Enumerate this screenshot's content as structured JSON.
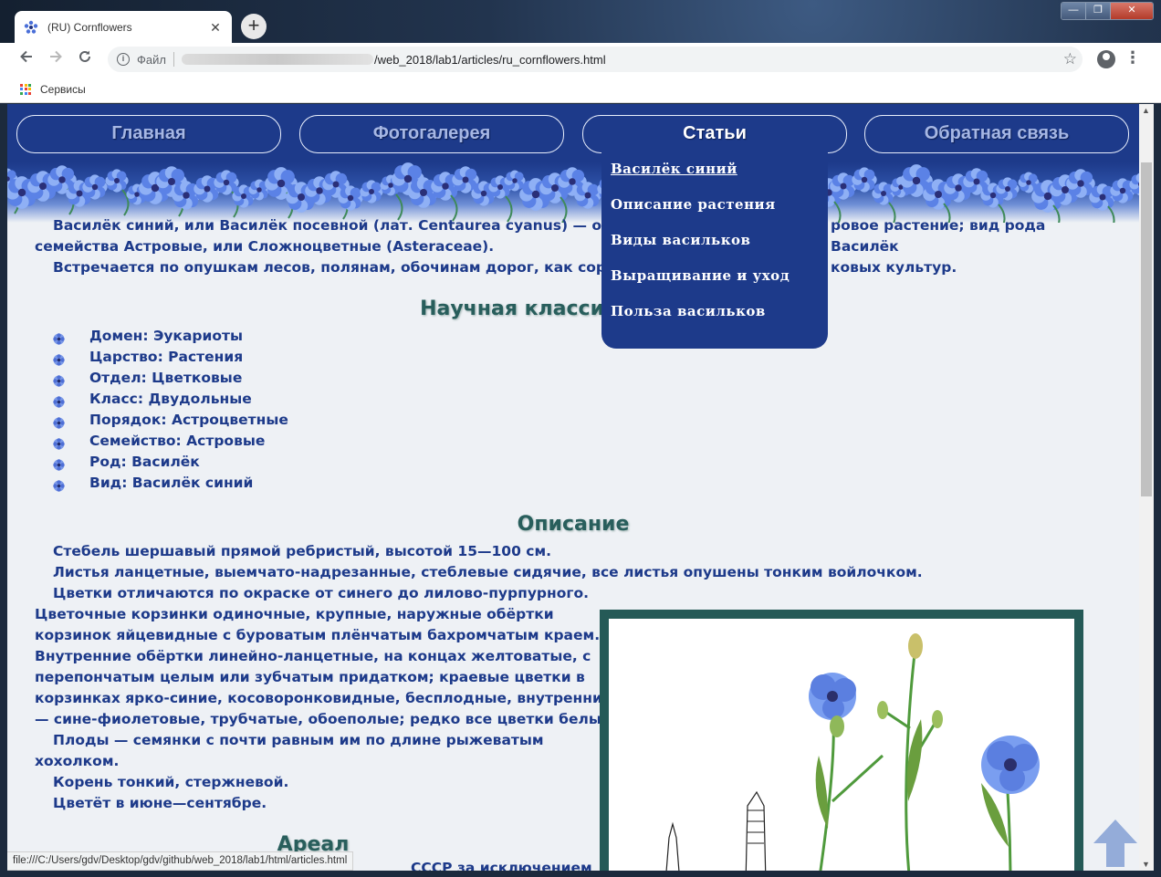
{
  "browser": {
    "tab_title": "(RU) Cornflowers",
    "tab_close": "✕",
    "new_tab": "+",
    "url_scheme_label": "Файл",
    "url_path": "/web_2018/lab1/articles/ru_cornflowers.html",
    "bookmarks_label": "Сервисы",
    "status_url": "file:///C:/Users/gdv/Desktop/gdv/github/web_2018/lab1/html/articles.html",
    "window_controls": [
      "—",
      "❐",
      "✕"
    ]
  },
  "nav": {
    "items": [
      "Главная",
      "Фотогалерея",
      "Статьи",
      "Обратная связь"
    ],
    "active": "Статьи"
  },
  "dropdown": {
    "items": [
      "Василёк синий",
      "Описание растения",
      "Виды васильков",
      "Выращивание и уход",
      "Польза васильков"
    ]
  },
  "article": {
    "intro_line1_left": "Василёк синий, или Василёк посевной (лат. Centaurea cyanus) — однолетн",
    "intro_line1_right": "ровое растение; вид рода Василёк",
    "intro_line2": "семейства Астровые, или Сложноцветные (Asteraceae).",
    "intro_line3_left": "Встречается по опушкам лесов, полянам, обочинам дорог, как сорное рас",
    "intro_line3_right": "ковых культур.",
    "heading_classification": "Научная класси",
    "taxonomy": [
      "Домен: Эукариоты",
      "Царство: Растения",
      "Отдел: Цветковые",
      "Класс: Двудольные",
      "Порядок: Астроцветные",
      "Семейство: Астровые",
      "Род: Василёк",
      "Вид: Василёк синий"
    ],
    "heading_description": "Описание",
    "desc_1": "Стебель шершавый прямой ребристый, высотой 15—100 см.",
    "desc_2": "Листья ланцетные, выемчато-надрезанные, стеблевые сидячие, все листья опушены тонким войлочком.",
    "desc_3": "Цветки отличаются по окраске от синего до лилово-пурпурного.",
    "desc_4_lines": [
      "Цветочные корзинки одиночные, крупные, наружные обёртки",
      "корзинок яйцевидные с буроватым плёнчатым бахромчатым краем.",
      "Внутренние обёртки линейно-ланцетные, на концах желтоватые, с",
      "перепончатым целым или зубчатым придатком; краевые цветки в",
      "корзинках ярко-синие, косоворонковидные, бесплодные, внутренние",
      "— сине-фиолетовые, трубчатые, обоеполые; редко все цветки белые."
    ],
    "desc_5a": "Плоды — семянки с почти равным им по длине рыжеватым",
    "desc_5b": "хохолком.",
    "desc_6": "Корень тонкий, стержневой.",
    "desc_7": "Цветёт в июне—сентябре.",
    "heading_area": "Ареал",
    "area_fragment": "СССР за исключением"
  }
}
